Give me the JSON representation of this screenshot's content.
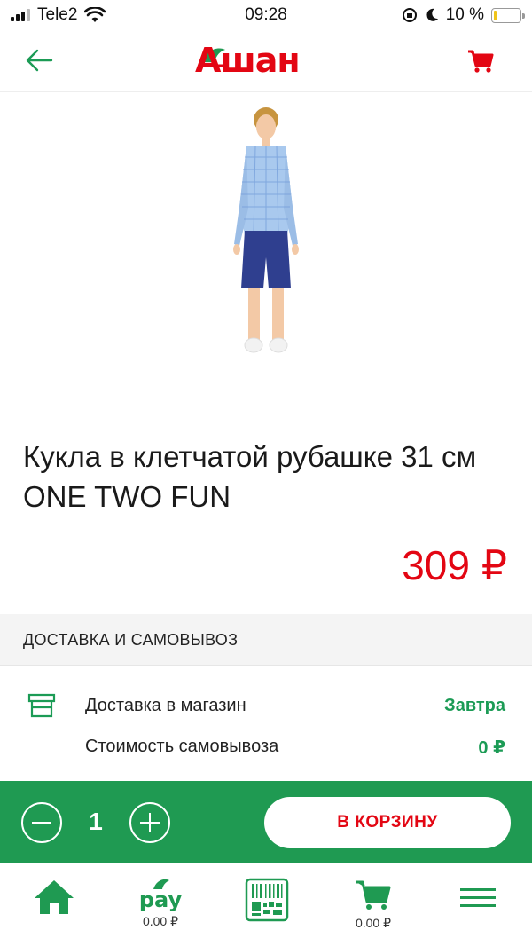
{
  "status_bar": {
    "carrier": "Tele2",
    "time": "09:28",
    "battery": "10 %",
    "battery_level": 0.1
  },
  "header": {
    "logo_text": "Ашан"
  },
  "product": {
    "title": "Кукла в клетчатой рубашке 31 см ONE TWO FUN",
    "price": "309 ₽"
  },
  "delivery": {
    "section_title": "ДОСТАВКА И САМОВЫВОЗ",
    "rows": [
      {
        "label": "Доставка в магазин",
        "value": "Завтра"
      },
      {
        "label": "Стоимость самовывоза",
        "value": "0 ₽"
      }
    ]
  },
  "action_bar": {
    "quantity": "1",
    "add_to_cart_label": "В КОРЗИНУ"
  },
  "bottom_nav": {
    "pay_label": "pay",
    "pay_amount": "0.00 ₽",
    "cart_amount": "0.00 ₽"
  },
  "colors": {
    "brand_red": "#e30613",
    "brand_green": "#1f9a52",
    "green_text": "#1b9b55"
  }
}
